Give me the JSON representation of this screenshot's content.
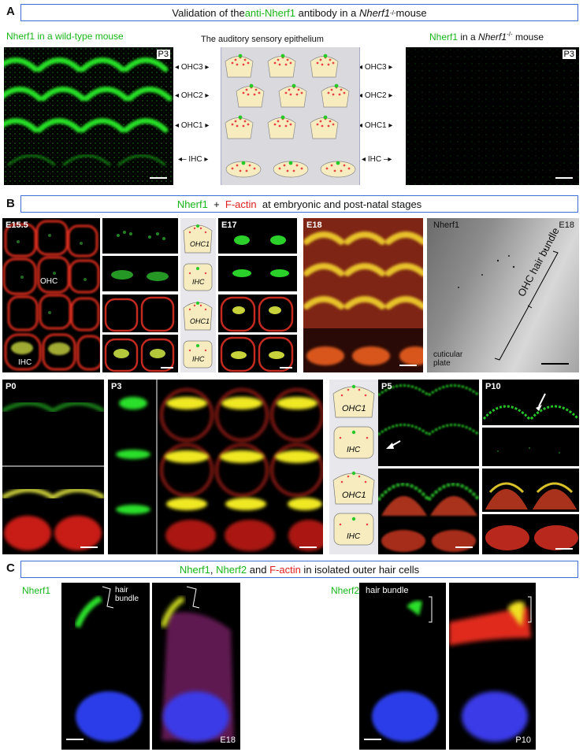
{
  "sectionA": {
    "letter": "A",
    "banner_pre": "Validation of the ",
    "banner_green": "anti-Nherf1",
    "banner_mid": " antibody in a ",
    "banner_italic": "Nherf1",
    "banner_sup": "-/-",
    "banner_post": " mouse",
    "wt_caption": "Nherf1 in a wild-type mouse",
    "ko_caption_green": "Nherf1",
    "ko_caption_mid": " in a ",
    "ko_caption_italic": "Nherf1",
    "ko_caption_sup": "-/-",
    "ko_caption_post": " mouse",
    "schematic_title": "The auditory sensory epithelium",
    "stage_wt": "P3",
    "stage_ko": "P3",
    "rows": [
      "OHC3",
      "OHC2",
      "OHC1",
      "IHC"
    ]
  },
  "sectionB": {
    "letter": "B",
    "banner_green": "Nherf1",
    "banner_plus": "  +  ",
    "banner_red": "F-actin",
    "banner_post": "  at embryonic and post-natal stages",
    "e155": "E15.5",
    "ohc": "OHC",
    "ihc": "IHC",
    "e17": "E17",
    "e18": "E18",
    "em_title": "Nherf1",
    "em_stage": "E18",
    "em_cuticular": "cuticular\nplate",
    "em_bundle": "OHC hair bundle",
    "p0": "P0",
    "p3": "P3",
    "p5": "P5",
    "p10": "P10",
    "schem_ohc1": "OHC1",
    "schem_ihc": "IHC"
  },
  "sectionC": {
    "letter": "C",
    "banner_g1": "Nherf1",
    "banner_sep": ", ",
    "banner_g2": "Nherf2",
    "banner_and": " and ",
    "banner_red": "F-actin",
    "banner_post": " in isolated outer hair cells",
    "label1": "Nherf1",
    "label2": "Nherf2",
    "hb1": "hair\nbundle",
    "hb2": "hair bundle",
    "stage1": "E18",
    "stage2": "P10"
  },
  "colors": {
    "green": "#19b519",
    "red": "#e0201c",
    "banner_border": "#3b6fd1",
    "cell_fill": "#f6ecc0"
  }
}
